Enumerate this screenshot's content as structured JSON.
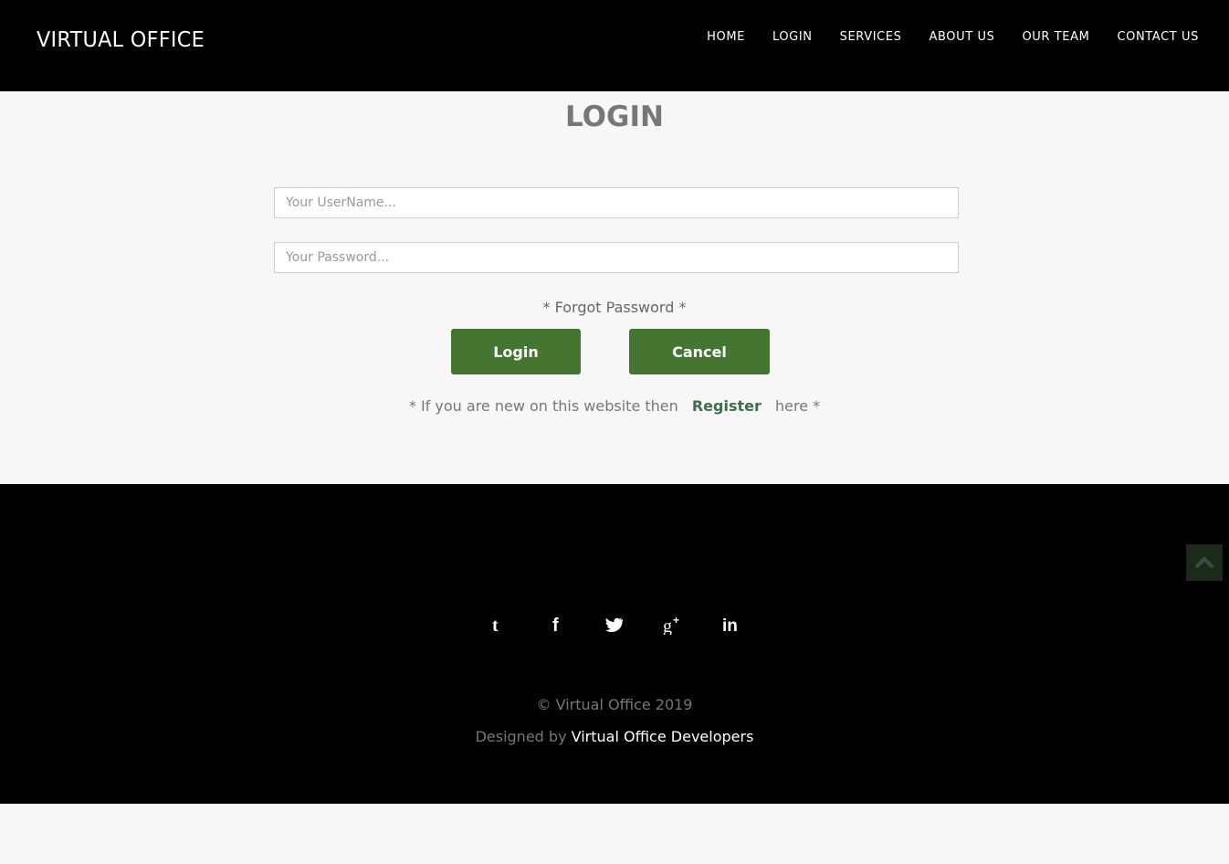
{
  "header": {
    "brand": "VIRTUAL OFFICE",
    "nav": [
      {
        "label": "HOME"
      },
      {
        "label": "LOGIN"
      },
      {
        "label": "SERVICES"
      },
      {
        "label": "ABOUT US"
      },
      {
        "label": "OUR TEAM"
      },
      {
        "label": "CONTACT US"
      }
    ]
  },
  "main": {
    "title": "LOGIN",
    "username": {
      "value": "",
      "placeholder": "Your UserName..."
    },
    "password": {
      "value": "",
      "placeholder": "Your Password..."
    },
    "forgot": "* Forgot Password *",
    "login_label": "Login",
    "cancel_label": "Cancel",
    "register_prefix": "* If you are new on this website then",
    "register_link": "Register",
    "register_suffix": "here *"
  },
  "footer": {
    "social_icons": [
      "tumblr-icon",
      "facebook-icon",
      "twitter-icon",
      "google-plus-icon",
      "linkedin-icon"
    ],
    "back_to_top_icon": "chevron-up-icon",
    "copyright": "© Virtual Office 2019",
    "designed_prefix": "Designed by",
    "designed_link": "Virtual Office Developers"
  },
  "colors": {
    "header_bg": "#000000",
    "button_bg": "#447531",
    "register_link": "#3a6e4f"
  }
}
